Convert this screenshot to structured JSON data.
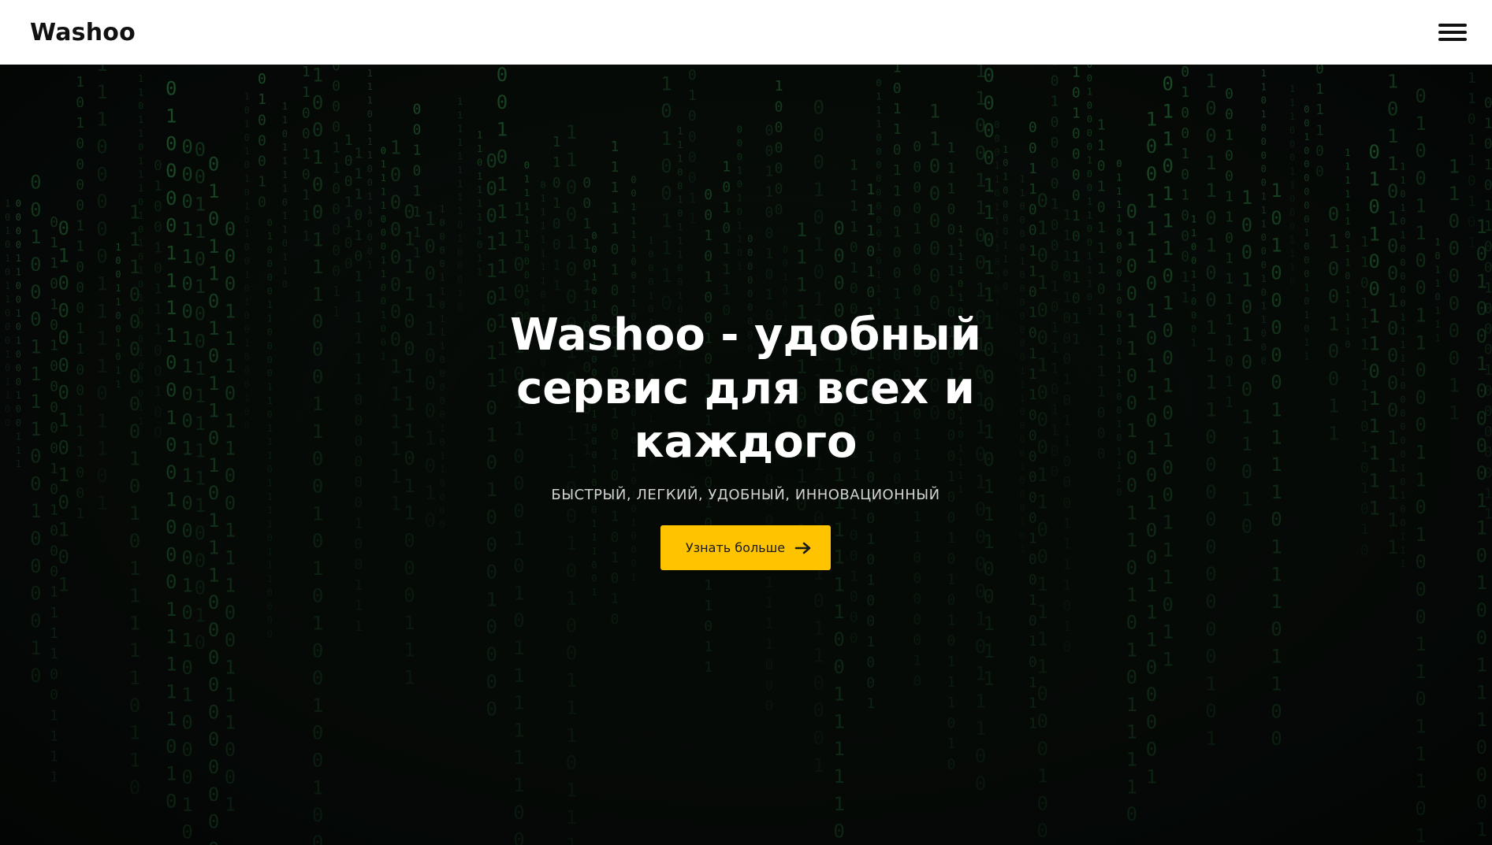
{
  "navbar": {
    "brand": "Washoo",
    "menu_icon": "hamburger-menu-icon"
  },
  "hero": {
    "title": "Washoo - удобный сервис для всех и каждого",
    "subtitle": "БЫСТРЫЙ, ЛЕГКИЙ, УДОБНЫЙ, ИННОВАЦИОННЫЙ",
    "cta_label": "Узнать больше",
    "cta_icon": "arrow-right-icon",
    "background": "binary-code-rain",
    "background_glyphs": [
      "0",
      "1"
    ]
  },
  "colors": {
    "navbar_bg": "#ffffff",
    "brand_text": "#111111",
    "hero_bg": "#050806",
    "rain_green": "#2f8a45",
    "title_text": "#ffffff",
    "subtitle_text": "#d2d2d2",
    "cta_bg": "#ffc300",
    "cta_text": "#1a1a1a"
  }
}
